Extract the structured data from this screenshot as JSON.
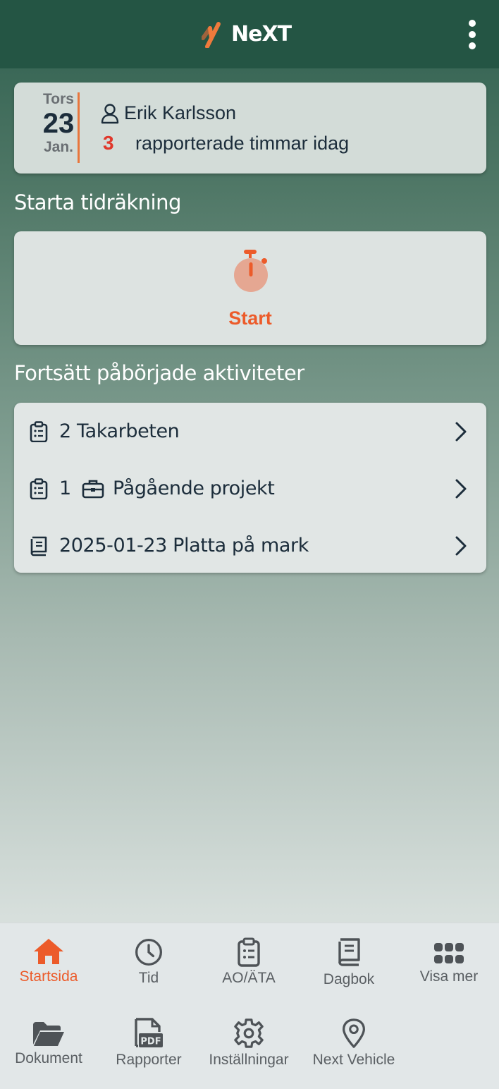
{
  "header": {
    "logo_text": "NeXT"
  },
  "date_card": {
    "weekday": "Tors",
    "day": "23",
    "month": "Jan.",
    "user_name": "Erik Karlsson",
    "hours_count": "3",
    "hours_text": "rapporterade timmar idag"
  },
  "start_section": {
    "title": "Starta tidräkning",
    "button_label": "Start"
  },
  "activities": {
    "title": "Fortsätt påbörjade aktiviteter",
    "items": [
      {
        "icon": "clipboard-icon",
        "label": "2 Takarbeten"
      },
      {
        "icon": "clipboard-icon",
        "count": "1",
        "label": "Pågående projekt"
      },
      {
        "icon": "book-icon",
        "label": "2025-01-23 Platta på mark"
      }
    ]
  },
  "bottom_nav": {
    "items": [
      {
        "label": "Startsida",
        "icon": "home-icon",
        "active": true
      },
      {
        "label": "Tid",
        "icon": "clock-icon"
      },
      {
        "label": "AO/ÄTA",
        "icon": "clipboard-icon"
      },
      {
        "label": "Dagbok",
        "icon": "book-icon"
      },
      {
        "label": "Visa mer",
        "icon": "grid-icon"
      },
      {
        "label": "Dokument",
        "icon": "folder-icon"
      },
      {
        "label": "Rapporter",
        "icon": "pdf-icon"
      },
      {
        "label": "Inställningar",
        "icon": "gear-icon"
      },
      {
        "label": "Next Vehicle",
        "icon": "location-pin-icon"
      }
    ]
  },
  "colors": {
    "header": "#245544",
    "accent": "#ec5b2a",
    "hours": "#e0382b"
  }
}
